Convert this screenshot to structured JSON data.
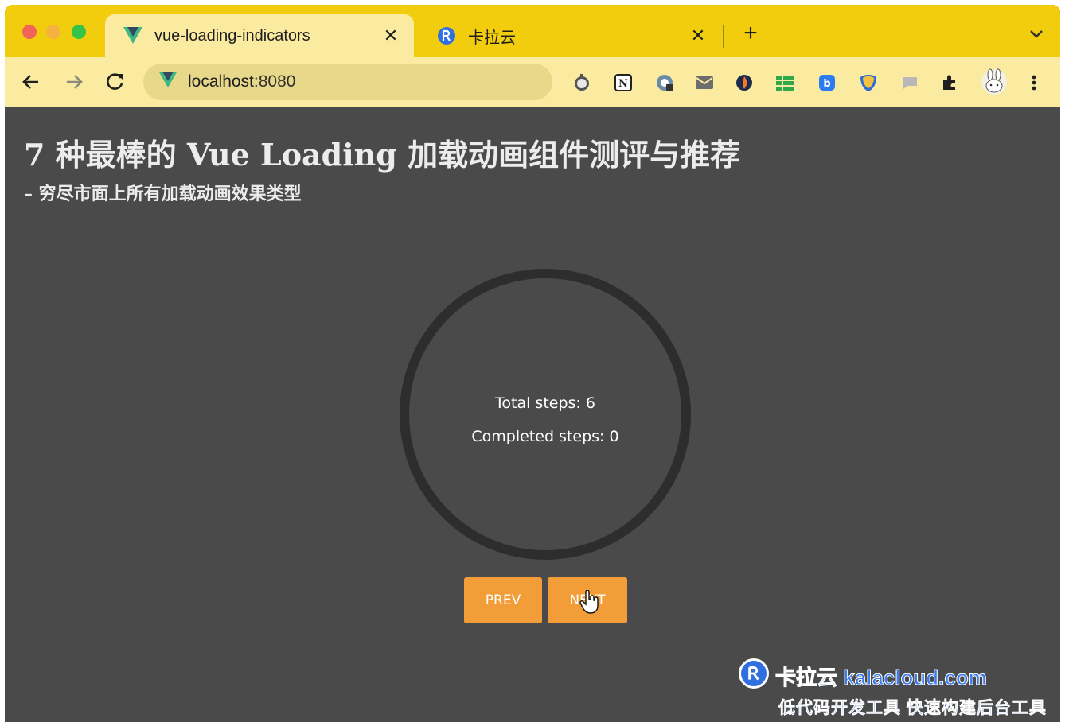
{
  "browser": {
    "tabs": [
      {
        "title": "vue-loading-indicators",
        "favicon": "vue-icon",
        "active": true
      },
      {
        "title": "卡拉云",
        "favicon": "kalacloud-icon",
        "active": false
      }
    ],
    "address": {
      "host": "localhost",
      "port": ":8080"
    },
    "extensions": [
      "timer-icon",
      "notion-icon",
      "tracker-icon",
      "mail-icon",
      "flame-icon",
      "sheet-icon",
      "blue-app-icon",
      "shield-icon",
      "chat-icon",
      "puzzle-icon",
      "rabbit-avatar",
      "menu-icon"
    ]
  },
  "page": {
    "headline": "7 种最棒的 Vue Loading 加载动画组件测评与推荐",
    "subheadline": "– 穷尽市面上所有加载动画效果类型",
    "progress": {
      "total_label": "Total steps: 6",
      "completed_label": "Completed steps: 0",
      "total_steps": 6,
      "completed_steps": 0
    },
    "buttons": {
      "prev": "PREV",
      "next": "NEXT"
    },
    "watermark": {
      "brand": "卡拉云 kalacloud.com",
      "slogan": "低代码开发工具 快速构建后台工具"
    }
  },
  "colors": {
    "tabstrip": "#f2cd0d",
    "toolbar": "#fbeba0",
    "page_bg": "#4a4a4a",
    "ring": "#2d2d2d",
    "button": "#f29d38",
    "watermark_blue": "#2f6fe0"
  }
}
